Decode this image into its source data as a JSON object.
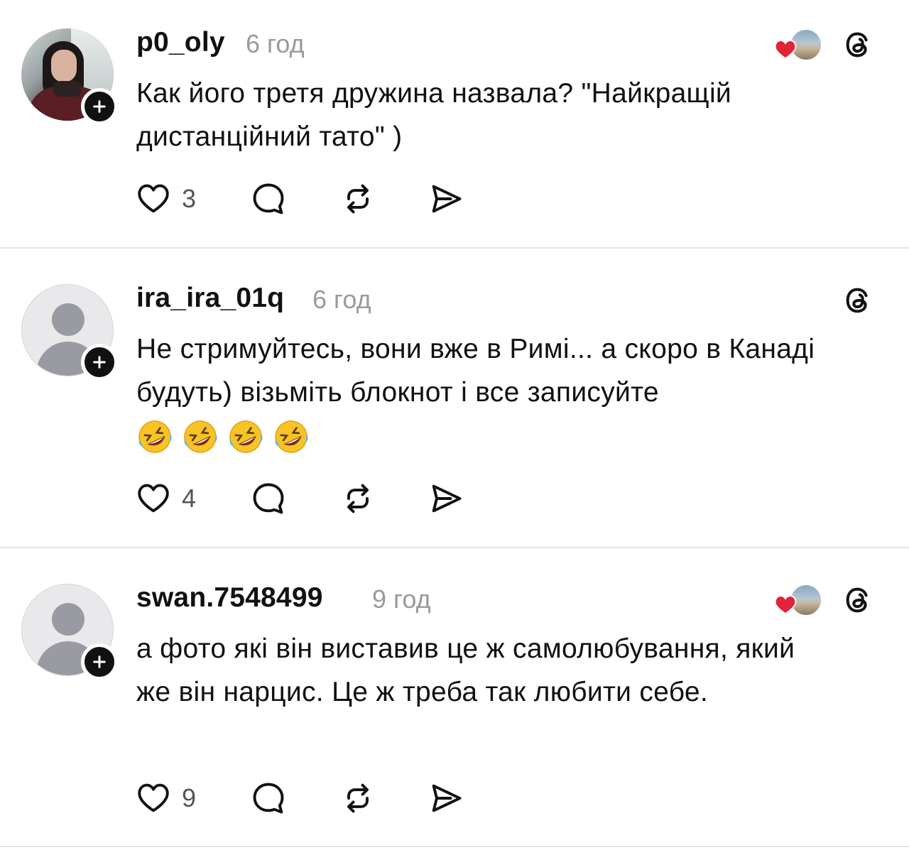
{
  "posts": [
    {
      "username": "p0_oly",
      "time": "6 год",
      "text": "Как його третя дружина назвала? \"Найкращій дистанційний тато\" )",
      "likes": "3",
      "avatar": "photo",
      "liked_by_author": true
    },
    {
      "username": "ira_ira_01q",
      "time": "6 год",
      "text": "Не стримуйтесь, вони вже в Римі... а скоро в Канаді будуть) візьміть блокнот і все записуйте",
      "emoji_count": 4,
      "emoji": "rolling-on-floor-laughing",
      "likes": "4",
      "avatar": "default",
      "liked_by_author": false
    },
    {
      "username": "swan.7548499",
      "time": "9 год",
      "text": "а фото які він виставив це ж самолюбування, який же він нарцис. Це ж треба так  любити себе.",
      "likes": "9",
      "avatar": "default",
      "liked_by_author": true
    }
  ],
  "icons": {
    "like": "heart-outline-icon",
    "reply": "comment-bubble-icon",
    "repost": "repost-icon",
    "share": "send-icon",
    "brand": "threads-logo-icon",
    "follow": "plus-icon",
    "liked_heart_color": "#e0243a"
  }
}
